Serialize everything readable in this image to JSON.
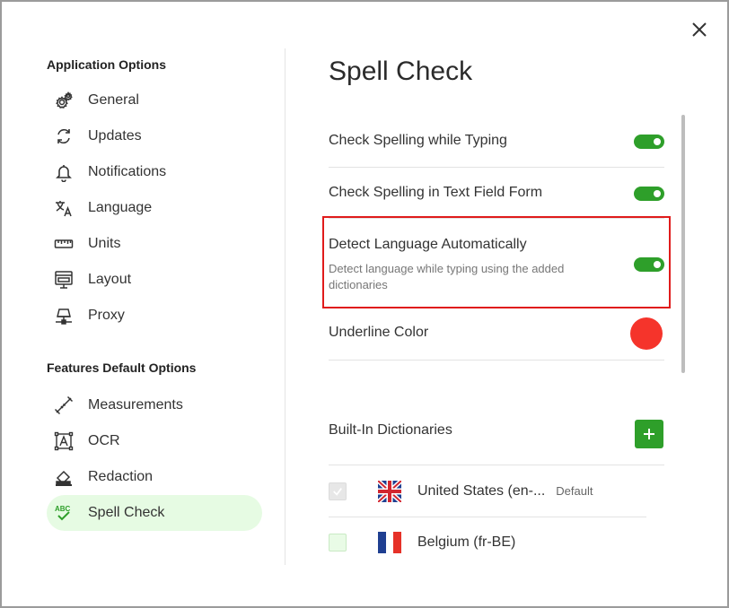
{
  "dialog": {
    "close_icon": "close-icon"
  },
  "sidebar": {
    "application_heading": "Application Options",
    "application_items": [
      {
        "label": "General",
        "icon": "gear-icon"
      },
      {
        "label": "Updates",
        "icon": "refresh-icon"
      },
      {
        "label": "Notifications",
        "icon": "bell-icon"
      },
      {
        "label": "Language",
        "icon": "translate-icon"
      },
      {
        "label": "Units",
        "icon": "ruler-icon"
      },
      {
        "label": "Layout",
        "icon": "layout-icon"
      },
      {
        "label": "Proxy",
        "icon": "network-icon"
      }
    ],
    "features_heading": "Features Default Options",
    "feature_items": [
      {
        "label": "Measurements",
        "icon": "measure-icon"
      },
      {
        "label": "OCR",
        "icon": "ocr-icon"
      },
      {
        "label": "Redaction",
        "icon": "eraser-icon"
      },
      {
        "label": "Spell Check",
        "icon": "spellcheck-icon",
        "active": true
      }
    ]
  },
  "main": {
    "title": "Spell Check",
    "settings": {
      "check_typing": {
        "label": "Check Spelling while Typing",
        "enabled": true
      },
      "check_form": {
        "label": "Check Spelling in Text Field Form",
        "enabled": true
      },
      "detect_language": {
        "label": "Detect Language Automatically",
        "description": "Detect language while typing using the added dictionaries",
        "enabled": true
      },
      "underline_color": {
        "label": "Underline Color",
        "color": "#f5342b"
      }
    },
    "dictionaries": {
      "label": "Built-In Dictionaries",
      "add_icon": "plus-icon",
      "items": [
        {
          "name": "United States (en-...",
          "badge": "Default",
          "checked": true,
          "flag": "uk-flag-icon"
        },
        {
          "name": "Belgium (fr-BE)",
          "badge": "",
          "checked": false,
          "flag": "france-flag-icon"
        }
      ]
    }
  },
  "colors": {
    "accent": "#2e9f2a",
    "active_bg": "#e6fbe3",
    "highlight": "#e01b1b"
  }
}
